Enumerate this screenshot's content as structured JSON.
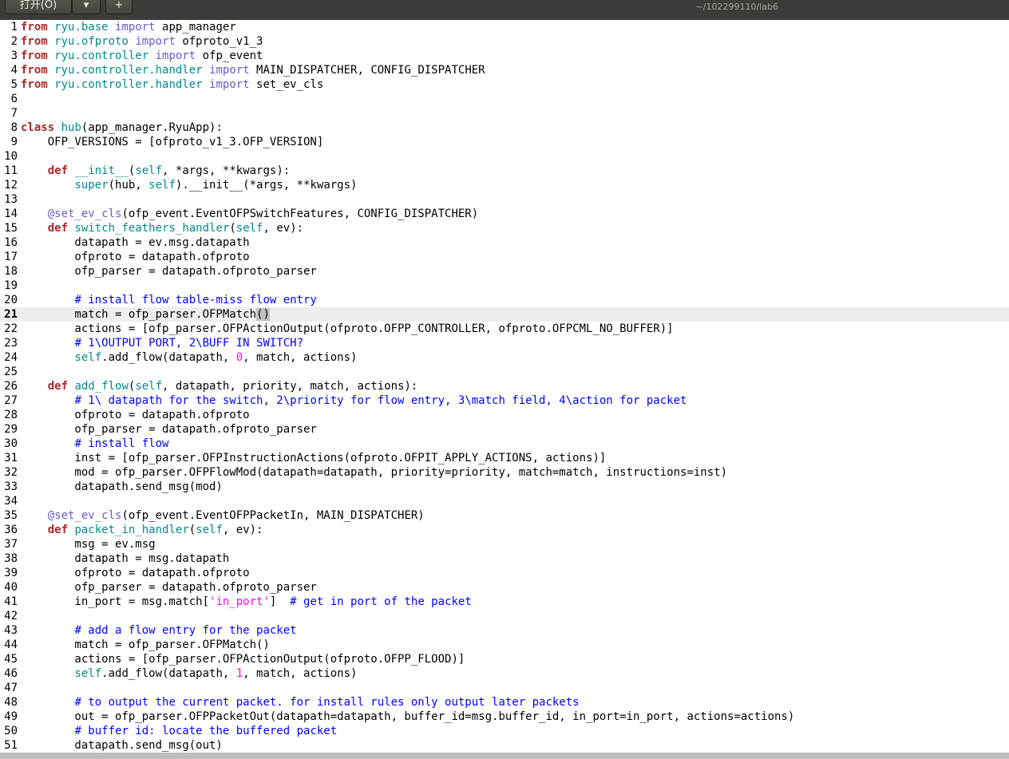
{
  "window": {
    "open_label": "打开(O)",
    "open_menu_icon": "chevron-down-icon",
    "new_tab_icon": "new-document-icon",
    "subtitle": "~/102299110/lab6"
  },
  "editor": {
    "current_line": 21,
    "language": "python",
    "lines": [
      {
        "n": "1",
        "tokens": [
          [
            "kw",
            "from"
          ],
          [
            "",
            "　"
          ]
        ]
      }
    ]
  }
}
